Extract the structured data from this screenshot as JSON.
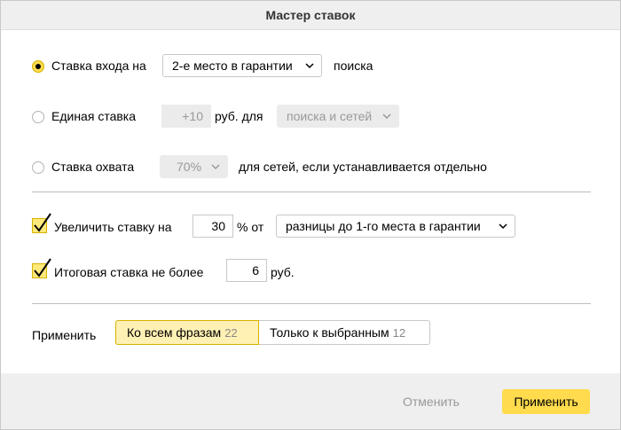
{
  "dialog": {
    "title": "Мастер ставок"
  },
  "entry_bid": {
    "label": "Ставка входа на",
    "selected": true,
    "select_value": "2-е место в гарантии",
    "suffix": "поиска"
  },
  "single_bid": {
    "label": "Единая ставка",
    "selected": false,
    "value": "+10",
    "unit": "руб. для",
    "select_value": "поиска и сетей"
  },
  "coverage_bid": {
    "label": "Ставка охвата",
    "selected": false,
    "select_value": "70%",
    "suffix": "для сетей, если устанавливается отдельно"
  },
  "increase": {
    "checked": true,
    "label": "Увеличить ставку на",
    "value": "30",
    "unit": "% от",
    "select_value": "разницы до 1-го места в гарантии"
  },
  "max_bid": {
    "checked": true,
    "label": "Итоговая ставка не более",
    "value": "6",
    "unit": "руб."
  },
  "apply_to": {
    "label": "Применить",
    "options": [
      {
        "label": "Ко всем фразам",
        "count": "22",
        "active": true
      },
      {
        "label": "Только к выбранным",
        "count": "12",
        "active": false
      }
    ]
  },
  "footer": {
    "cancel_label": "Отменить",
    "apply_label": "Применить"
  },
  "colors": {
    "accent": "#ffdb4d",
    "accent_light": "#fff0b3"
  }
}
